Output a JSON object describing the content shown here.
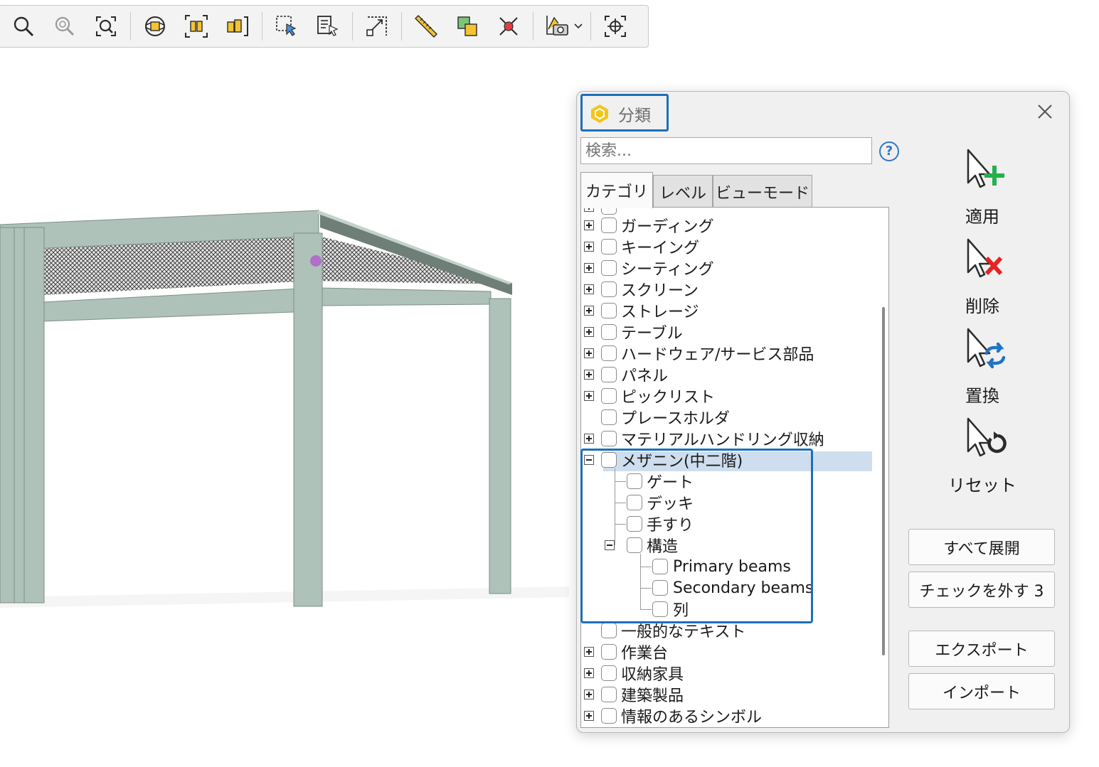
{
  "toolbar": {
    "items": [
      "zoom-icon",
      "zoom-window-icon",
      "zoom-fit-icon",
      "orbit-icon",
      "frame-all-icon",
      "frame-selection-icon",
      "select-box-icon",
      "select-list-icon",
      "measure-area-icon",
      "ruler-icon",
      "section-box-icon",
      "clear-selection-icon",
      "camera-view-icon",
      "navigate-icon"
    ]
  },
  "dialog": {
    "title": "分類",
    "search_placeholder": "検索...",
    "help_label": "?",
    "tabs": [
      "カテゴリ",
      "レベル",
      "ビューモード"
    ],
    "tree": {
      "rows": [
        {
          "label": "ガーディング"
        },
        {
          "label": "キーイング"
        },
        {
          "label": "シーティング"
        },
        {
          "label": "スクリーン"
        },
        {
          "label": "ストレージ"
        },
        {
          "label": "テーブル"
        },
        {
          "label": "ハードウェア/サービス部品"
        },
        {
          "label": "パネル"
        },
        {
          "label": "ピックリスト"
        },
        {
          "label": "プレースホルダ"
        },
        {
          "label": "マテリアルハンドリング収納"
        },
        {
          "label": "メザニン(中二階)"
        },
        {
          "label": "ゲート"
        },
        {
          "label": "デッキ"
        },
        {
          "label": "手すり"
        },
        {
          "label": "構造"
        },
        {
          "label": "Primary beams"
        },
        {
          "label": "Secondary beams"
        },
        {
          "label": "列"
        },
        {
          "label": "一般的なテキスト"
        },
        {
          "label": "作業台"
        },
        {
          "label": "収納家具"
        },
        {
          "label": "建築製品"
        },
        {
          "label": "情報のあるシンボル"
        }
      ]
    },
    "actions": [
      {
        "label": "適用",
        "icon": "apply-icon"
      },
      {
        "label": "削除",
        "icon": "remove-icon"
      },
      {
        "label": "置換",
        "icon": "replace-icon"
      },
      {
        "label": "リセット",
        "icon": "reset-icon"
      }
    ],
    "buttons": {
      "expand_all": "すべて展開",
      "uncheck": "チェックを外す 3",
      "export": "エクスポート",
      "import": "インポート"
    }
  },
  "colors": {
    "highlight": "#1c6fb8",
    "selection": "#cfdeee",
    "structure": "#aec2b9",
    "apply_green": "#22b14c",
    "remove_red": "#e32424",
    "replace_blue": "#1e73c7"
  }
}
